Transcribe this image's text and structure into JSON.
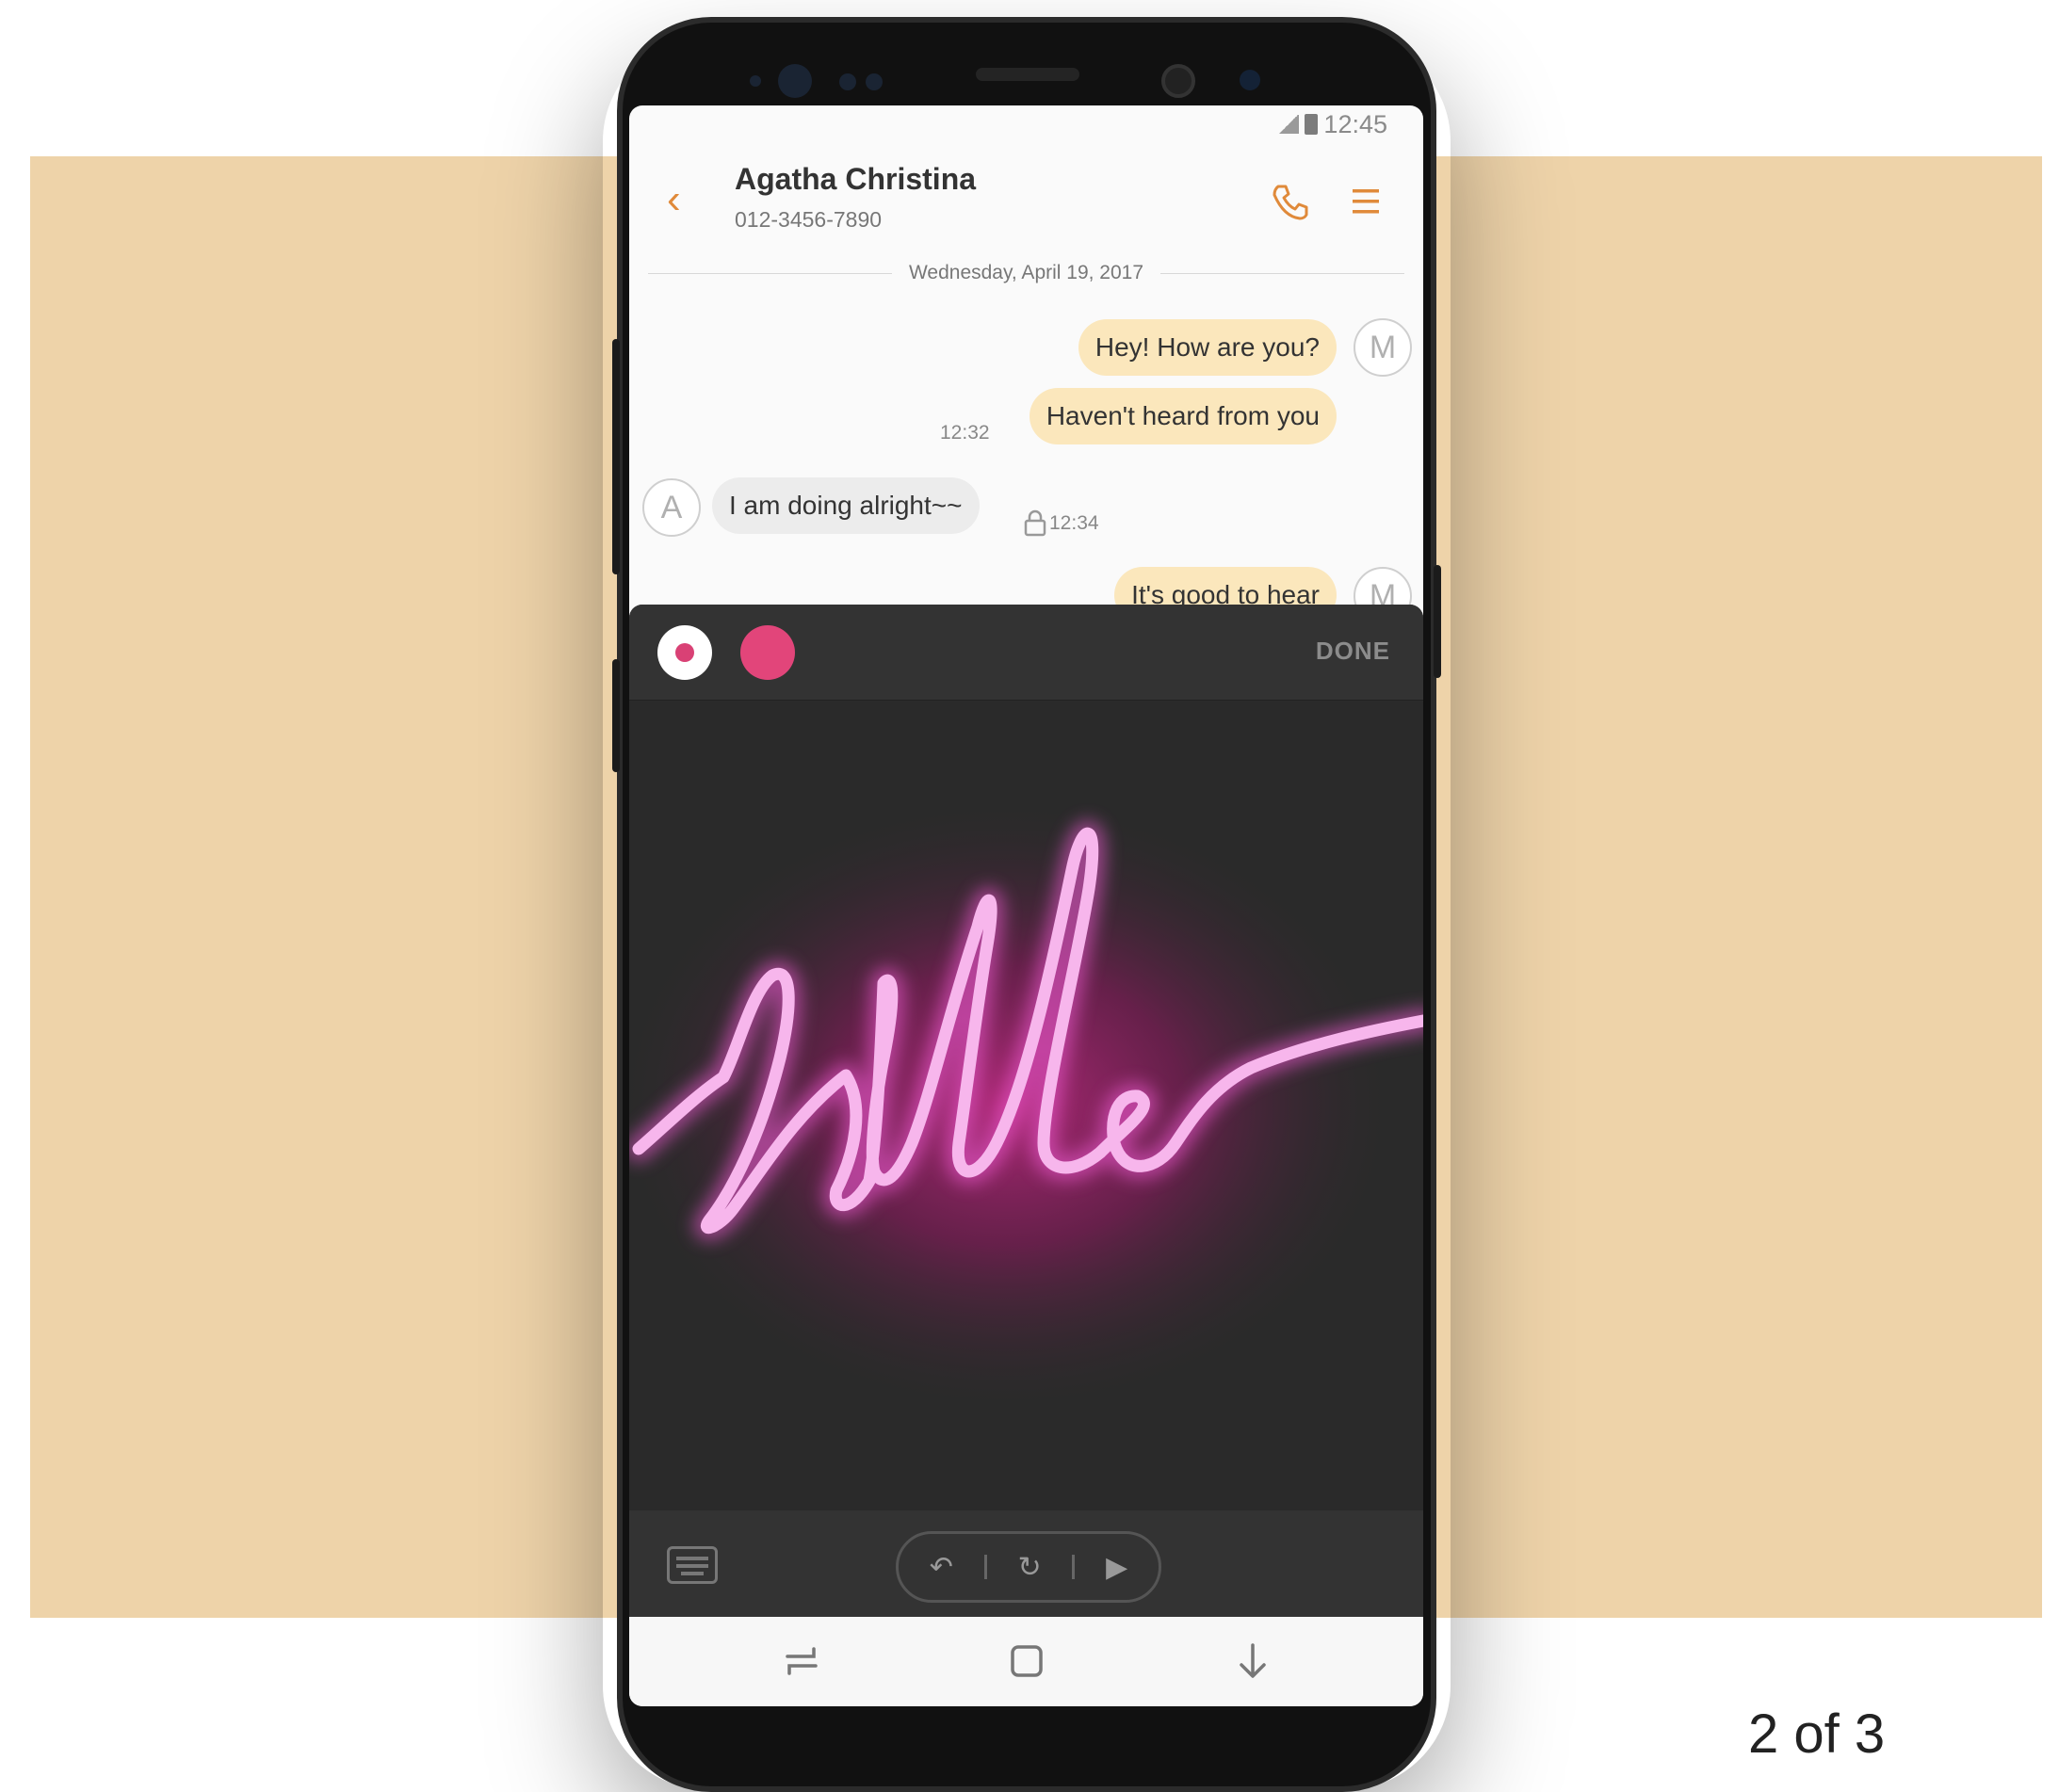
{
  "status_bar": {
    "time": "12:45"
  },
  "header": {
    "contact_name": "Agatha Christina",
    "contact_number": "012-3456-7890"
  },
  "conversation": {
    "date": "Wednesday, April 19, 2017",
    "messages": [
      {
        "text": "Hey! How are you?",
        "sender_initial": "M",
        "direction": "out"
      },
      {
        "text": "Haven't heard from you",
        "time": "12:32",
        "direction": "out"
      },
      {
        "text": "I am doing alright~~",
        "sender_initial": "A",
        "time": "12:34",
        "direction": "in"
      },
      {
        "text": "It's good to hear",
        "sender_initial": "M",
        "direction": "out"
      }
    ]
  },
  "live_message": {
    "done_label": "DONE",
    "drawn_word": "Hello",
    "pen_color": "#e2457a",
    "stroke_color": "#f7b6ec"
  },
  "colors": {
    "background": "#eed3a9",
    "accent": "#e08a3a",
    "bubble_out": "#fbe7bc",
    "bubble_in": "#ececec"
  },
  "icons": [
    "back-arrow-icon",
    "phone-icon",
    "menu-icon",
    "keyboard-icon",
    "undo-icon",
    "reset-icon",
    "play-icon",
    "recent-apps-icon",
    "home-icon",
    "back-down-icon"
  ],
  "carousel": {
    "page_indicator": "2 of 3"
  }
}
